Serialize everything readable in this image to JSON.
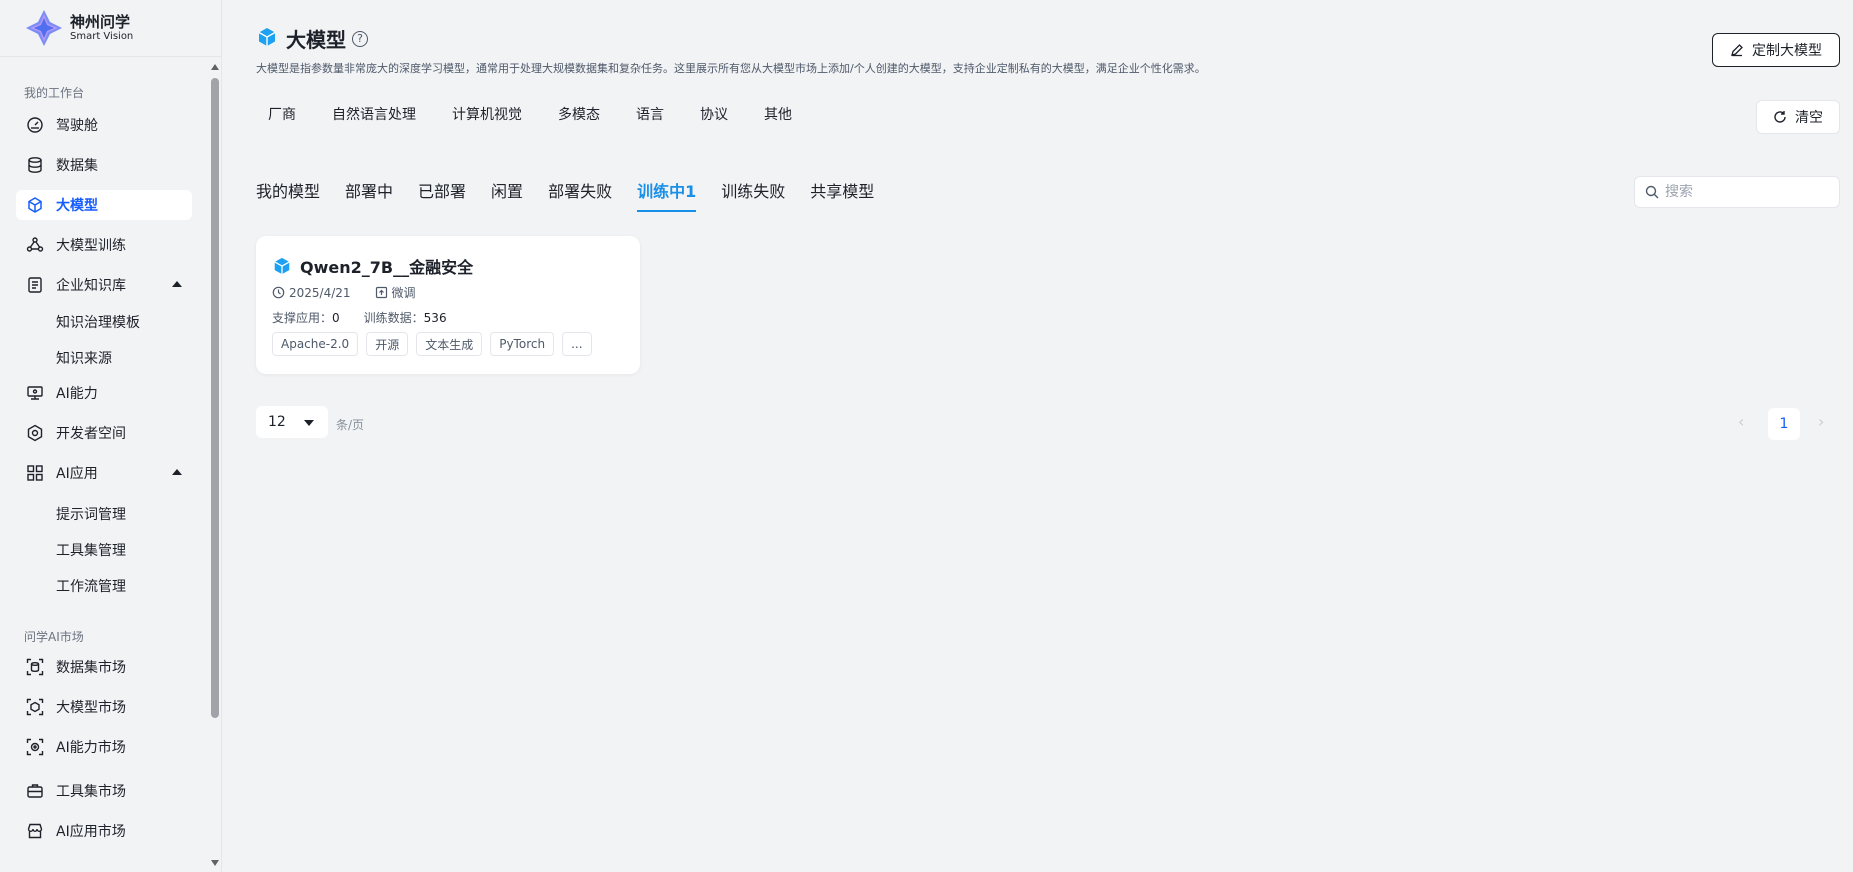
{
  "brand": {
    "name_cn": "神州问学",
    "name_en": "Smart Vision"
  },
  "sidebar": {
    "workbench_title": "我的工作台",
    "items": [
      {
        "label": "驾驶舱",
        "icon": "dashboard-icon"
      },
      {
        "label": "数据集",
        "icon": "database-icon"
      },
      {
        "label": "大模型",
        "icon": "cube-icon",
        "active": true
      },
      {
        "label": "大模型训练",
        "icon": "training-icon"
      },
      {
        "label": "企业知识库",
        "icon": "knowledge-icon",
        "expanded": true
      },
      {
        "label": "AI能力",
        "icon": "monitor-icon"
      },
      {
        "label": "开发者空间",
        "icon": "developer-icon"
      },
      {
        "label": "AI应用",
        "icon": "apps-grid-icon",
        "expanded": true
      }
    ],
    "knowledge_children": [
      "知识治理模板",
      "知识来源"
    ],
    "ai_app_children": [
      "提示词管理",
      "工具集管理",
      "工作流管理"
    ],
    "market_title": "问学AI市场",
    "market_items": [
      {
        "label": "数据集市场",
        "icon": "dataset-market-icon"
      },
      {
        "label": "大模型市场",
        "icon": "model-market-icon"
      },
      {
        "label": "AI能力市场",
        "icon": "ai-market-icon"
      },
      {
        "label": "工具集市场",
        "icon": "toolbox-icon"
      },
      {
        "label": "AI应用市场",
        "icon": "store-icon"
      }
    ]
  },
  "header": {
    "title": "大模型",
    "help": "?",
    "description": "大模型是指参数量非常庞大的深度学习模型，通常用于处理大规模数据集和复杂任务。这里展示所有您从大模型市场上添加/个人创建的大模型，支持企业定制私有的大模型，满足企业个性化需求。",
    "custom_button": "定制大模型",
    "clear_button": "清空"
  },
  "filters": [
    "厂商",
    "自然语言处理",
    "计算机视觉",
    "多模态",
    "语言",
    "协议",
    "其他"
  ],
  "tabs": [
    {
      "label": "我的模型"
    },
    {
      "label": "部署中"
    },
    {
      "label": "已部署"
    },
    {
      "label": "闲置"
    },
    {
      "label": "部署失败"
    },
    {
      "label": "训练中1",
      "active": true
    },
    {
      "label": "训练失败"
    },
    {
      "label": "共享模型"
    }
  ],
  "search": {
    "placeholder": "搜索",
    "value": ""
  },
  "card": {
    "name": "Qwen2_7B__金融安全",
    "date": "2025/4/21",
    "type": "微调",
    "apps_label": "支撑应用：",
    "apps_value": "0",
    "train_label": "训练数据：",
    "train_value": "536",
    "tags": [
      "Apache-2.0",
      "开源",
      "文本生成",
      "PyTorch",
      "..."
    ]
  },
  "pagination": {
    "page_size": "12",
    "unit": "条/页",
    "current": "1",
    "prev": "‹",
    "next": "›"
  },
  "colors": {
    "accent": "#165dff",
    "tab_active": "#1890e8",
    "icon_blue": "#1da1f2"
  }
}
